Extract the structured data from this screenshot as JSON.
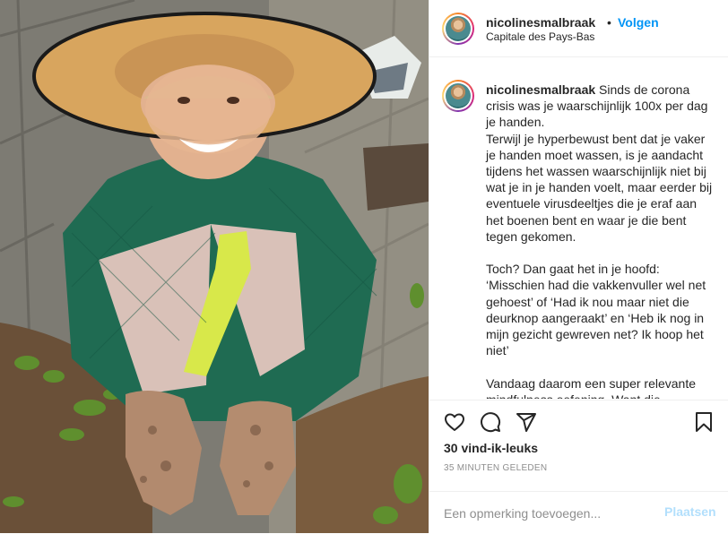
{
  "header": {
    "username": "nicolinesmalbraak",
    "separator": "•",
    "follow_label": "Volgen",
    "location": "Capitale des Pays-Bas"
  },
  "caption": {
    "username": "nicolinesmalbraak",
    "text": " Sinds de corona crisis was je waarschijnlijk 100x per dag je handen.\nTerwijl je hyperbewust bent dat je vaker je handen moet wassen, is je aandacht tijdens het wassen waarschijnlijk niet bij wat je in je handen voelt, maar eerder bij eventuele virusdeeltjes die je eraf aan het boenen bent en waar je die bent tegen gekomen.\n\nToch? Dan gaat het in je hoofd: ‘Misschien had die vakkenvuller wel net gehoest’ of ‘Had ik nou maar niet die deurknop aangeraakt’ en ‘Heb ik nog in mijn gezicht gewreven net? Ik hoop het niet’\n\nVandaag daarom een super relevante mindfulness oefening. Want die"
  },
  "actions": {
    "icons": [
      "heart-icon",
      "comment-icon",
      "share-icon",
      "bookmark-icon"
    ],
    "likes": "30 vind-ik-leuks",
    "time": "35 MINUTEN GELEDEN"
  },
  "comment": {
    "placeholder": "Een opmerking toevoegen...",
    "post_label": "Plaatsen"
  },
  "colors": {
    "link_blue": "#0095f6",
    "post_disabled": "#b2dffc",
    "secondary_text": "#8e8e8e",
    "divider": "#efefef"
  }
}
